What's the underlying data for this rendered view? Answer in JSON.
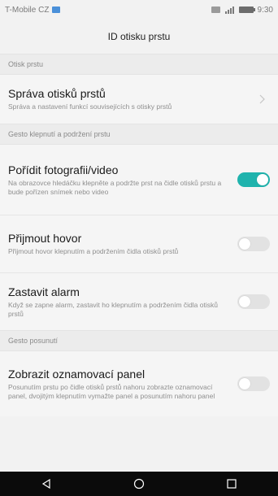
{
  "status_bar": {
    "carrier": "T-Mobile CZ",
    "time": "9:30",
    "icons": [
      "carrier-icon",
      "notification-icon",
      "signal-icon",
      "battery-icon"
    ]
  },
  "header": {
    "title": "ID otisku prstu"
  },
  "sections": [
    {
      "label": "Otisk prstu",
      "items": [
        {
          "title": "Správa otisků prstů",
          "description": "Správa a nastavení funkcí souvisejících s otisky prstů",
          "control": "chevron-right-icon"
        }
      ]
    },
    {
      "label": "Gesto klepnutí a podržení prstu",
      "items": [
        {
          "title": "Pořídit fotografii/video",
          "description": "Na obrazovce hledáčku klepněte a podržte prst na čidle otisků prstu a bude pořízen snímek nebo video",
          "toggle_on": true
        },
        {
          "title": "Přijmout hovor",
          "description": "Přijmout hovor klepnutím a podržením čidla otisků prstů",
          "toggle_on": false
        },
        {
          "title": "Zastavit alarm",
          "description": "Když se zapne alarm, zastavit ho klepnutím a podržením čidla otisků prstů",
          "toggle_on": false
        }
      ]
    },
    {
      "label": "Gesto posunutí",
      "items": [
        {
          "title": "Zobrazit oznamovací panel",
          "description": "Posunutím prstu po čidle otisků prstů nahoru zobrazte oznamovací panel, dvojitým klepnutím vymažte panel a posunutím nahoru panel",
          "toggle_on": false
        }
      ]
    }
  ],
  "navigation_bar": {
    "buttons": [
      "back-icon",
      "home-icon",
      "recents-icon"
    ]
  },
  "colors": {
    "accent": "#1fb3ad",
    "background": "#f2f2f2",
    "navbar": "#0b0b0b"
  }
}
